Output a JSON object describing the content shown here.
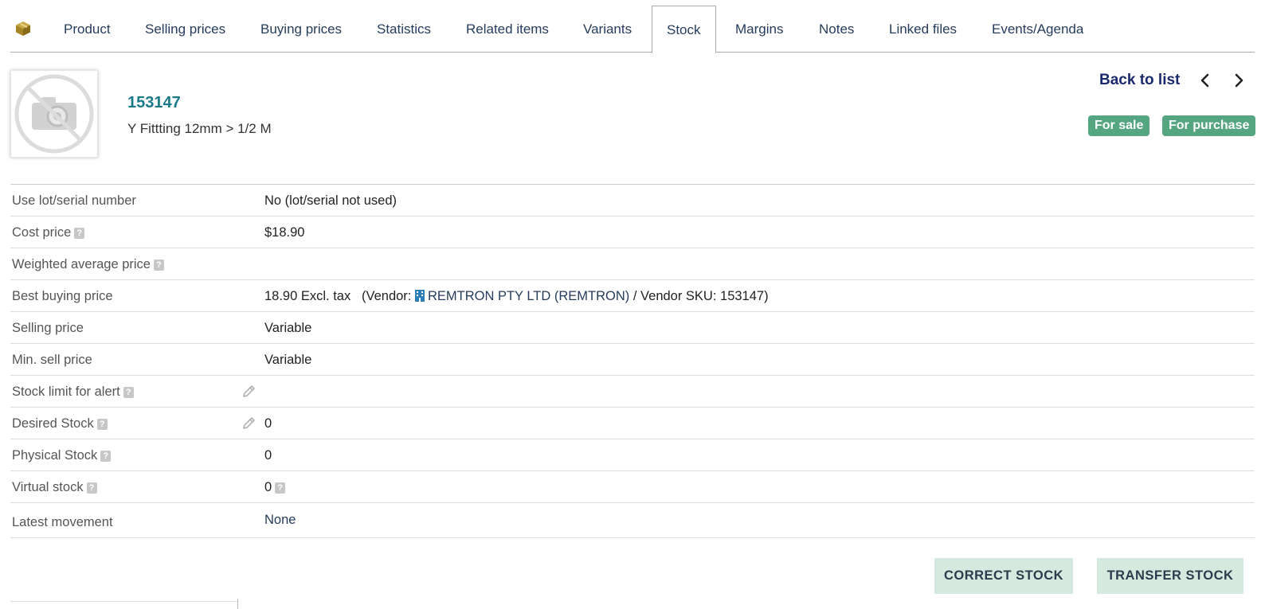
{
  "tabs": [
    {
      "label": "Product"
    },
    {
      "label": "Selling prices"
    },
    {
      "label": "Buying prices"
    },
    {
      "label": "Statistics"
    },
    {
      "label": "Related items"
    },
    {
      "label": "Variants"
    },
    {
      "label": "Stock"
    },
    {
      "label": "Margins"
    },
    {
      "label": "Notes"
    },
    {
      "label": "Linked files"
    },
    {
      "label": "Events/Agenda"
    }
  ],
  "active_tab": "Stock",
  "product": {
    "ref": "153147",
    "label": "Y Fittting 12mm > 1/2 M"
  },
  "nav": {
    "back_label": "Back to list"
  },
  "badges": {
    "for_sale": "For sale",
    "for_purchase": "For purchase"
  },
  "fields": {
    "lot": {
      "label": "Use lot/serial number",
      "value": "No (lot/serial not used)"
    },
    "cost_price": {
      "label": "Cost price",
      "value": "$18.90"
    },
    "wap": {
      "label": "Weighted average price",
      "value": ""
    },
    "best_buying": {
      "label": "Best buying price",
      "price": "18.90 Excl. tax",
      "vendor_prefix": "(Vendor:",
      "vendor_name": "REMTRON PTY LTD (REMTRON)",
      "sku": "/ Vendor SKU: 153147)"
    },
    "selling_price": {
      "label": "Selling price",
      "value": "Variable"
    },
    "min_sell_price": {
      "label": "Min. sell price",
      "value": "Variable"
    },
    "stock_limit": {
      "label": "Stock limit for alert",
      "value": ""
    },
    "desired_stock": {
      "label": "Desired Stock",
      "value": "0"
    },
    "physical_stock": {
      "label": "Physical Stock",
      "value": "0"
    },
    "virtual_stock": {
      "label": "Virtual stock",
      "value": "0"
    },
    "latest_movement": {
      "label": "Latest movement",
      "value": "None"
    }
  },
  "buttons": {
    "correct_stock": "CORRECT STOCK",
    "transfer_stock": "TRANSFER STOCK"
  },
  "colors": {
    "badge": "#55a580",
    "button_bg": "#d6e9de",
    "ref": "#1b7a8a",
    "link": "#263c5c"
  },
  "icons": {
    "module": "product-box-icon",
    "photo": "no-photo-icon",
    "help": "help-icon",
    "edit": "pencil-icon",
    "vendor": "building-icon"
  }
}
